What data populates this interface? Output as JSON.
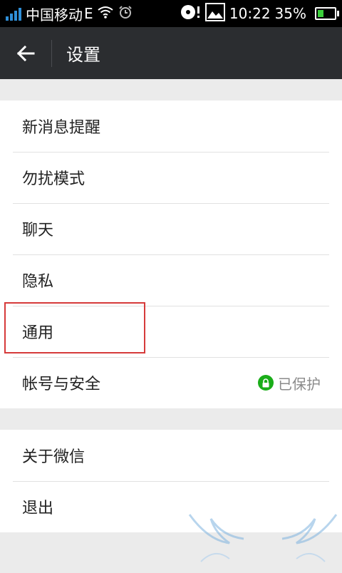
{
  "status_bar": {
    "carrier": "中国移动",
    "network": "E",
    "time": "10:22",
    "battery": "35%",
    "battery_level": 0.35
  },
  "app_bar": {
    "title": "设置",
    "back_icon": "back-arrow-icon"
  },
  "settings_group_1": [
    {
      "label": "新消息提醒"
    },
    {
      "label": "勿扰模式"
    },
    {
      "label": "聊天"
    },
    {
      "label": "隐私"
    },
    {
      "label": "通用"
    },
    {
      "label": "帐号与安全",
      "status": "已保护"
    }
  ],
  "settings_group_2": [
    {
      "label": "关于微信"
    },
    {
      "label": "退出"
    }
  ],
  "colors": {
    "status_bar": "#000000",
    "app_bar": "#2b2d30",
    "accent_green": "#1aad19",
    "highlight": "#d63a3a",
    "background": "#ebebeb"
  }
}
